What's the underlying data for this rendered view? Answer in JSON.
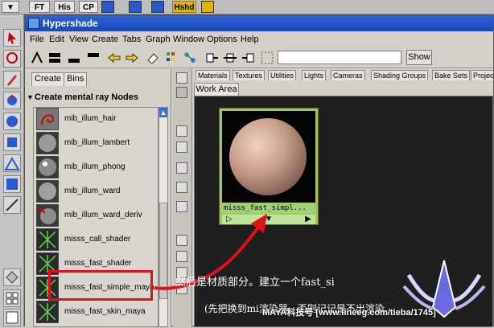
{
  "shelf": {
    "buttons": [
      "FT",
      "His",
      "CP",
      "Hshd"
    ]
  },
  "window": {
    "title": "Hypershade"
  },
  "menubar": {
    "items": [
      "File",
      "Edit",
      "View",
      "Create",
      "Tabs",
      "Graph",
      "Window",
      "Options",
      "Help"
    ]
  },
  "toolbar": {
    "search_value": "",
    "show_label": "Show"
  },
  "left_panel": {
    "tabs": [
      "Create",
      "Bins"
    ],
    "header": "Create mental ray Nodes",
    "nodes": [
      {
        "label": "mib_illum_hair",
        "icon": "hair-curl-icon"
      },
      {
        "label": "mib_illum_lambert",
        "icon": "gray-sphere-icon"
      },
      {
        "label": "mib_illum_phong",
        "icon": "shiny-sphere-icon"
      },
      {
        "label": "mib_illum_ward",
        "icon": "gray-sphere-icon"
      },
      {
        "label": "mib_illum_ward_deriv",
        "icon": "sphere-arrow-icon"
      },
      {
        "label": "misss_call_shader",
        "icon": "green-spark-icon"
      },
      {
        "label": "misss_fast_shader",
        "icon": "green-spark-icon"
      },
      {
        "label": "misss_fast_simple_maya",
        "icon": "green-spark-icon"
      },
      {
        "label": "misss_fast_skin_maya",
        "icon": "green-spark-icon"
      }
    ]
  },
  "top_tabs": [
    "Materials",
    "Textures",
    "Utilities",
    "Lights",
    "Cameras",
    "Shading Groups",
    "Bake Sets",
    "Projects"
  ],
  "work_area": {
    "tab_label": "Work Area",
    "swatch_label": "misss_fast_simpl..."
  },
  "overlay": {
    "line1": "然后是材质部分。建立一个fast_si",
    "line2": "(先把换到mi渲染器，否则记记是不出渲染",
    "watermark": "MAYA科技号 [www.lineeg.com/tieba/1745]"
  },
  "colors": {
    "titlebar": "#1b46b6",
    "swatch_border": "#a6c45a",
    "annotation_red": "#e0101a"
  }
}
